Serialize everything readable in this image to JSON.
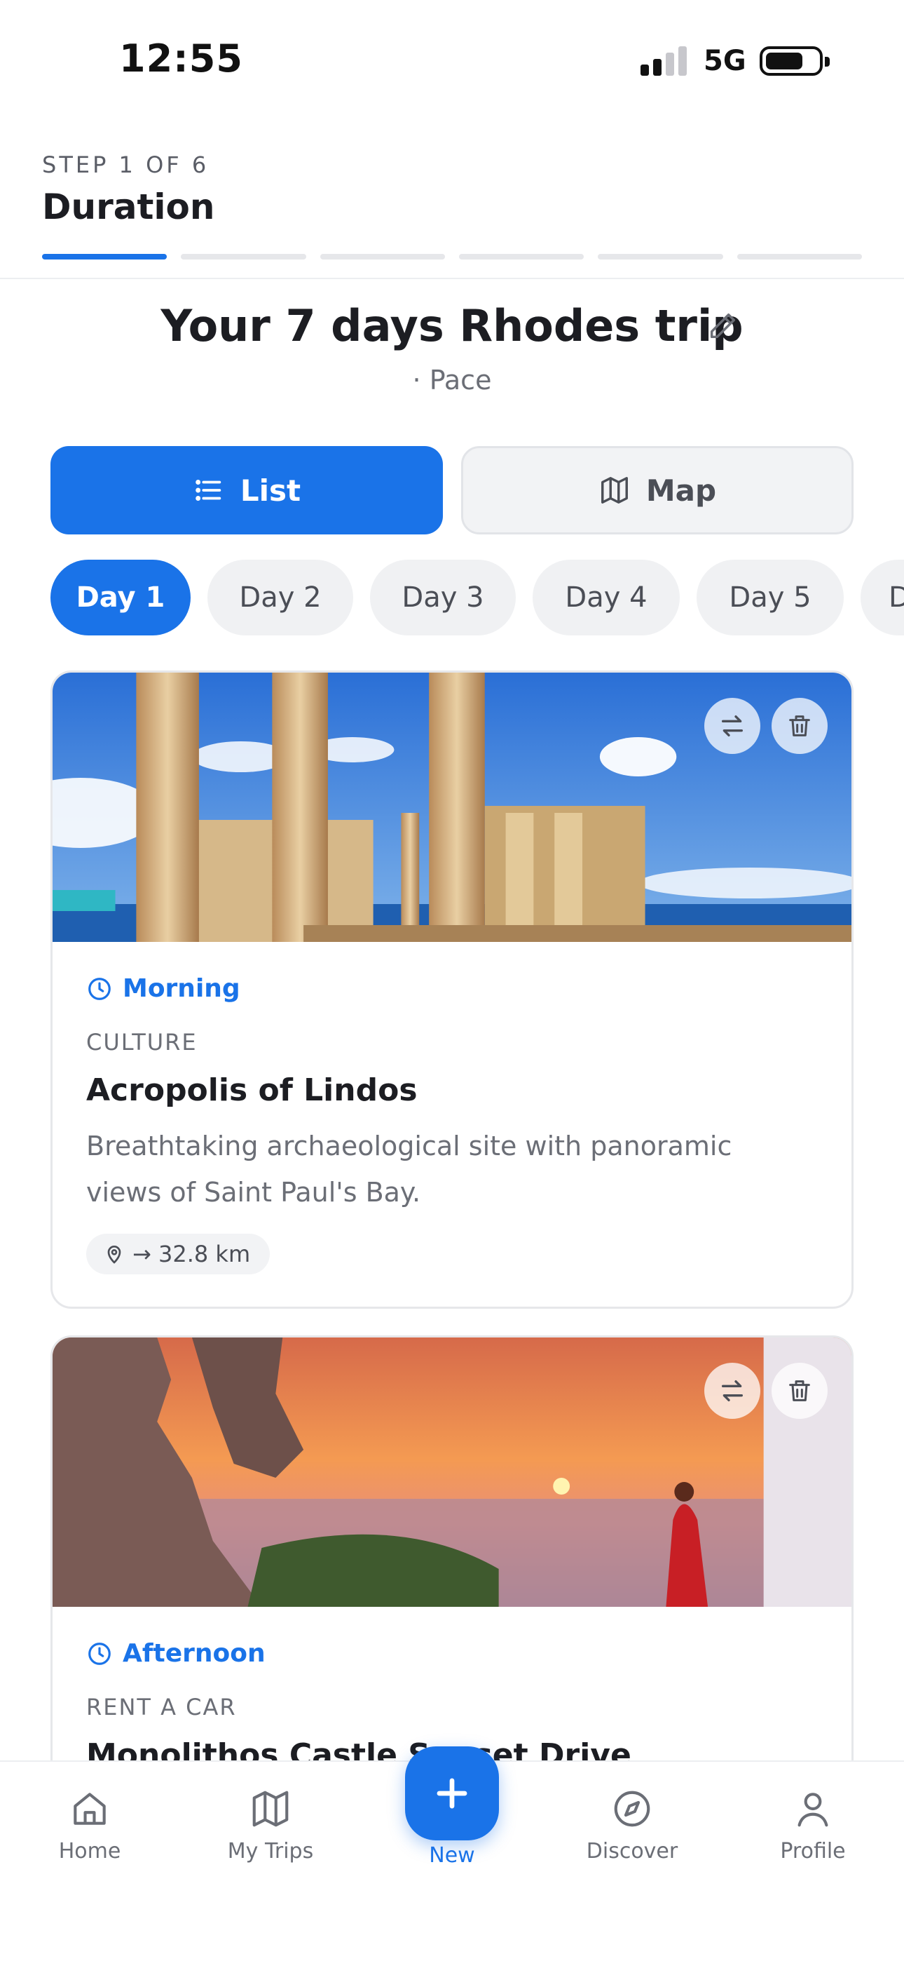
{
  "status_bar": {
    "time": "12:55",
    "network": "5G"
  },
  "wizard": {
    "step_label": "STEP 1 OF 6",
    "step_title": "Duration",
    "steps_total": 6,
    "steps_completed": 1
  },
  "trip": {
    "title": "Your 7 days Rhodes trip",
    "subtitle": "· Pace"
  },
  "view_toggle": {
    "list_label": "List",
    "map_label": "Map",
    "selected": "List"
  },
  "days": [
    "Day 1",
    "Day 2",
    "Day 3",
    "Day 4",
    "Day 5",
    "D"
  ],
  "selected_day": "Day 1",
  "activities": [
    {
      "time_of_day": "Morning",
      "category": "CULTURE",
      "title": "Acropolis of Lindos",
      "description_line1": "Breathtaking archaeological site with panoramic",
      "description_line2": "views of Saint Paul's Bay.",
      "distance": "→ 32.8 km"
    },
    {
      "time_of_day": "Afternoon",
      "category": "RENT A CAR",
      "title": "Monolithos Castle Sunset Drive"
    }
  ],
  "nav": {
    "home": "Home",
    "my_trips": "My Trips",
    "new": "New",
    "discover": "Discover",
    "profile": "Profile"
  },
  "colors": {
    "accent": "#1a73e8",
    "text": "#1c1d22",
    "muted": "#6b6e76",
    "chip_bg": "#f0f1f3"
  },
  "icons": [
    "pencil-icon",
    "list-icon",
    "map-icon",
    "swap-icon",
    "trash-icon",
    "clock-icon",
    "location-pin-icon",
    "home-icon",
    "map-icon",
    "plus-icon",
    "compass-icon",
    "person-icon"
  ]
}
